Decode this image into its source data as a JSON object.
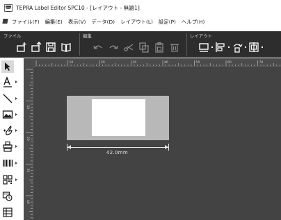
{
  "window": {
    "title": "TEPRA Label Editor SPC10 - [レイアウト - 無題1]"
  },
  "menu": {
    "items": [
      {
        "label": "ファイル(F)"
      },
      {
        "label": "編集(E)"
      },
      {
        "label": "表示(V)"
      },
      {
        "label": "データ(D)"
      },
      {
        "label": "レイアウト(L)"
      },
      {
        "label": "設定(P)"
      },
      {
        "label": "ヘルプ(H)"
      }
    ]
  },
  "ribbon": {
    "groups": [
      {
        "label": "ファイル"
      },
      {
        "label": "編集"
      },
      {
        "label": "レイアウト"
      }
    ],
    "theme": {
      "background": "#2d2d2d",
      "icon": "#ffffff",
      "disabled_icon": "#8a8a8a"
    }
  },
  "tools": [
    {
      "name": "select-arrow-icon",
      "selected": true
    },
    {
      "name": "text-tool-icon"
    },
    {
      "name": "line-tool-icon"
    },
    {
      "name": "image-tool-icon"
    },
    {
      "name": "clipart-tool-icon"
    },
    {
      "name": "stamp-tool-icon"
    },
    {
      "name": "barcode-tool-icon"
    },
    {
      "name": "qrcode-tool-icon"
    },
    {
      "name": "date-time-tool-icon"
    },
    {
      "name": "table-tool-icon"
    }
  ],
  "ruler": {
    "top_labels": [
      "10",
      "20",
      "30",
      "40",
      "50",
      "60",
      "70",
      "80"
    ],
    "left_labels": [
      "10",
      "20",
      "30",
      "40"
    ]
  },
  "label": {
    "length_text": "42.0mm"
  },
  "colors": {
    "workspace": "#434343",
    "tape": "#b8b8b8",
    "print_area": "#ffffff"
  }
}
